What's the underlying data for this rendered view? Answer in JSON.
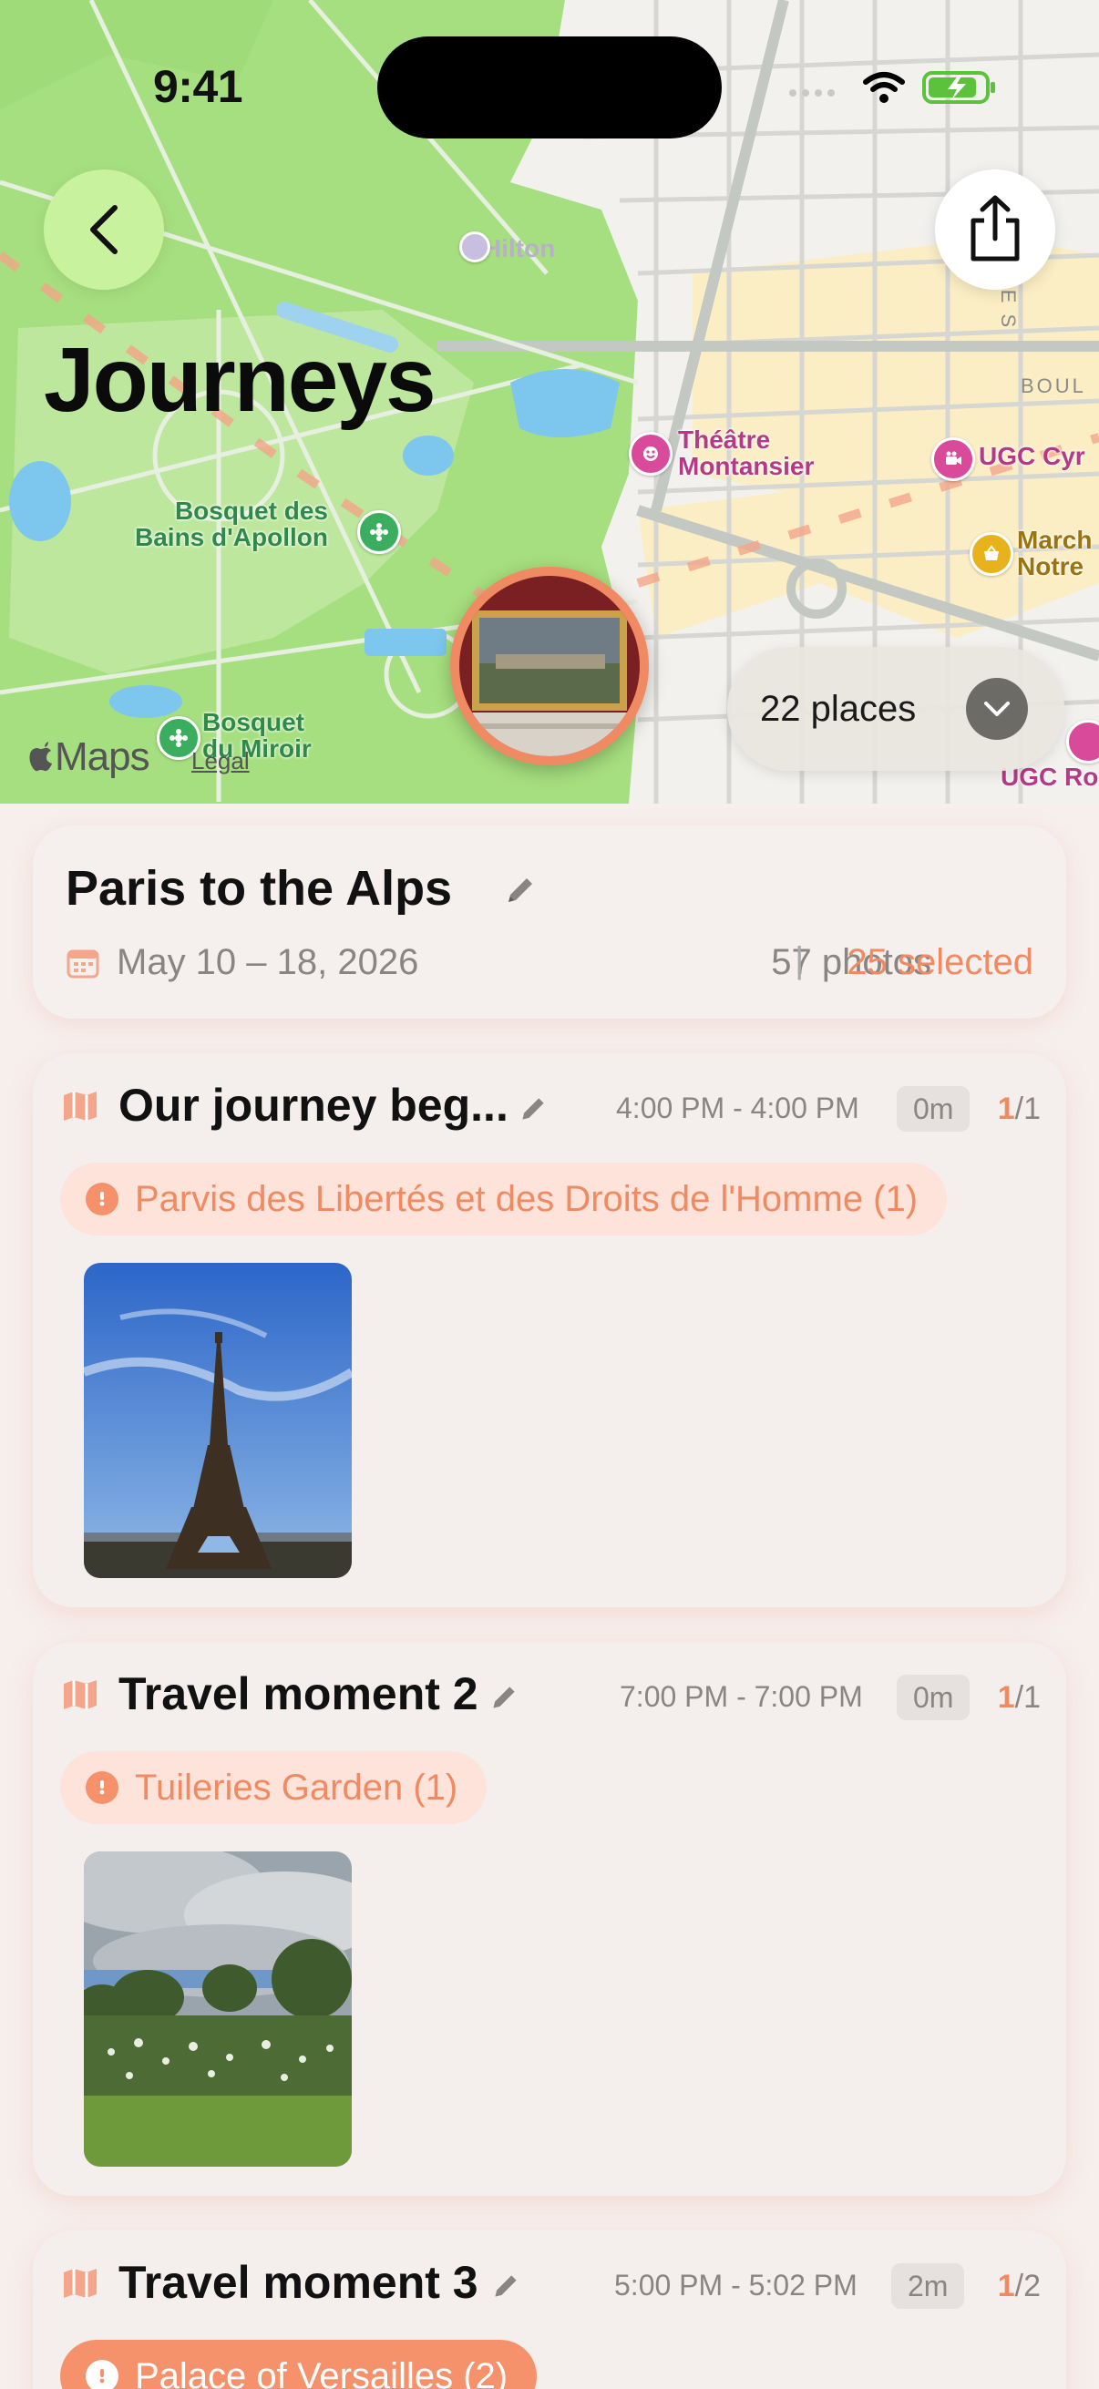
{
  "status_bar": {
    "time": "9:41"
  },
  "map": {
    "title": "Journeys",
    "labels": {
      "hilton": "Hilton",
      "bosquet_bains": "Bosquet des\nBains d'Apollon",
      "bosquet_miroir": "Bosquet\ndu Miroir",
      "theatre": "Théâtre\nMontansier",
      "ugc_cyrano": "UGC Cyr",
      "ugc_roi": "UGC Ro",
      "marche": "March\nNotre",
      "boulevard": "BOUL",
      "rue": "RUE S"
    },
    "places_count": "22 places",
    "maps_brand": "Maps",
    "legal": "Legal"
  },
  "trip": {
    "title": "Paris to the Alps",
    "date": "May 10 – 18, 2026",
    "photos": "57 photos",
    "separator": "|",
    "selected": "25 selected"
  },
  "moments": [
    {
      "title": "Our journey beg...",
      "time": "4:00 PM - 4:00 PM",
      "duration": "0m",
      "count_selected": "1",
      "count_total": "/1",
      "place": "Parvis des Libertés et des Droits de l'Homme (1)",
      "place_active": false
    },
    {
      "title": "Travel moment 2",
      "time": "7:00 PM - 7:00 PM",
      "duration": "0m",
      "count_selected": "1",
      "count_total": "/1",
      "place": "Tuileries Garden (1)",
      "place_active": false
    },
    {
      "title": "Travel moment 3",
      "time": "5:00 PM - 5:02 PM",
      "duration": "2m",
      "count_selected": "1",
      "count_total": "/2",
      "place": "Palace of Versailles (2)",
      "place_active": true
    }
  ],
  "colors": {
    "accent": "#f08a63",
    "back_button": "#c9f29e",
    "card": "#f4efec",
    "place_chip": "#fde3d9"
  },
  "icons": [
    "chevron-left-icon",
    "share-icon",
    "chevron-down-icon",
    "calendar-icon",
    "pencil-icon",
    "map-icon",
    "pin-icon",
    "wifi-icon",
    "battery-icon",
    "apple-icon"
  ]
}
